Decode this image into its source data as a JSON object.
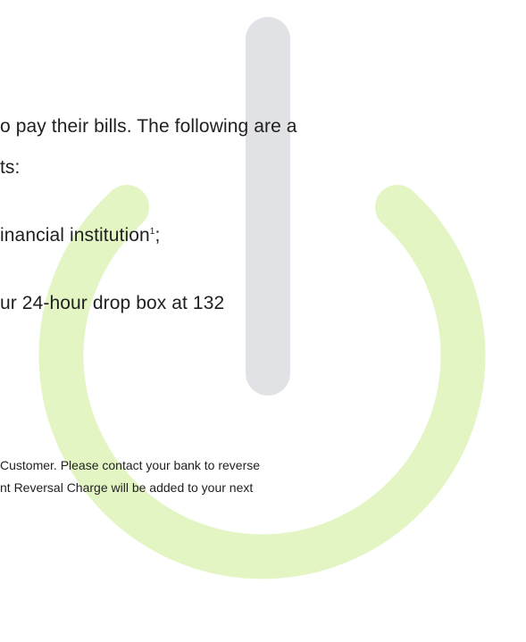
{
  "paragraph": {
    "line1": "o pay their bills.  The following are a",
    "line2": "ts:"
  },
  "list": {
    "item1_text": "inancial institution",
    "item1_footnote_ref": "1",
    "item1_suffix": ";",
    "item2_text": "ur 24-hour drop box at 132"
  },
  "footnote": {
    "line1": "Customer. Please contact your bank to reverse",
    "line2": "nt Reversal Charge will be added to your next"
  },
  "watermark": {
    "icon": "power-icon",
    "ring_color": "#e4f5c4",
    "bar_color": "#e1e2e6"
  }
}
